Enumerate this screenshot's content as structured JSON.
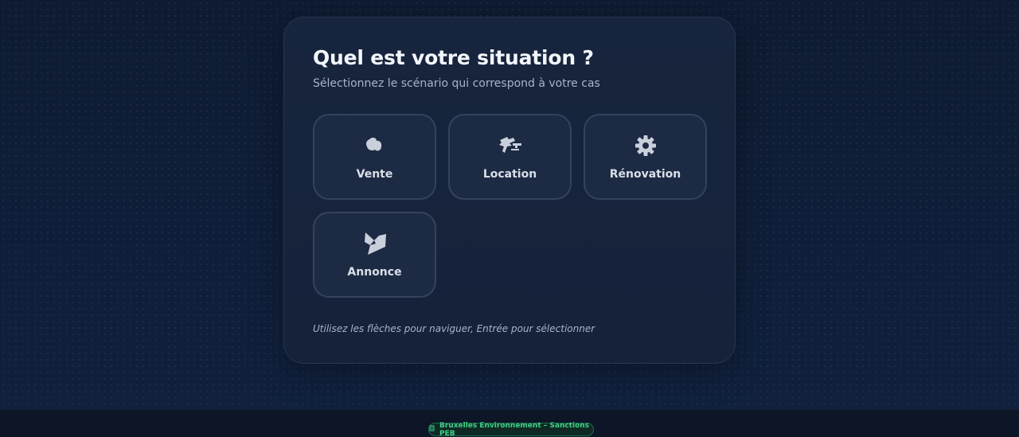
{
  "card": {
    "title": "Quel est votre situation ?",
    "subtitle": "Sélectionnez le scénario qui correspond à votre cas",
    "hint": "Utilisez les flèches pour naviguer, Entrée pour sélectionner"
  },
  "options": [
    {
      "label": "Vente",
      "icon": "blob-icon"
    },
    {
      "label": "Location",
      "icon": "key-transfer-icon"
    },
    {
      "label": "Rénovation",
      "icon": "gear-icon"
    },
    {
      "label": "Annonce",
      "icon": "megaphone-icon"
    }
  ],
  "footer": {
    "badge_icon": "document-icon",
    "badge_text": "Bruxelles Environnement – Sanctions PEB"
  },
  "colors": {
    "background": "#0f1d36",
    "card": "#17243d",
    "option_border": "#34425d",
    "badge_text": "#3fd28a"
  }
}
